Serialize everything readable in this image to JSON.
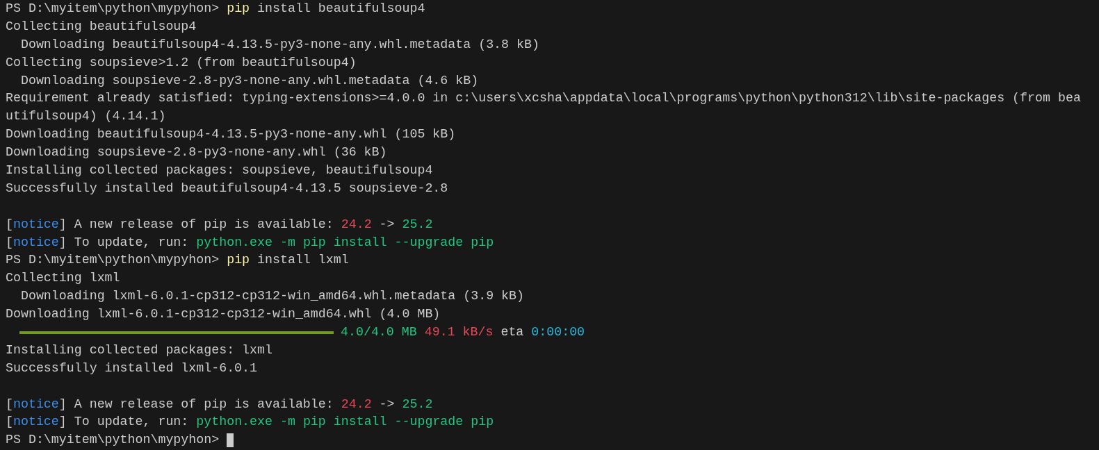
{
  "lines": [
    {
      "kind": "text",
      "segments": [
        {
          "text": "PS D:\\myitem\\python\\mypyhon> "
        },
        {
          "color": "#f9f1a5",
          "text": "pip"
        },
        {
          "text": " install beautifulsoup4"
        }
      ]
    },
    {
      "kind": "text",
      "segments": [
        {
          "text": "Collecting beautifulsoup4"
        }
      ]
    },
    {
      "kind": "text",
      "segments": [
        {
          "text": "  Downloading beautifulsoup4-4.13.5-py3-none-any.whl.metadata (3.8 kB)"
        }
      ]
    },
    {
      "kind": "text",
      "segments": [
        {
          "text": "Collecting soupsieve>1.2 (from beautifulsoup4)"
        }
      ]
    },
    {
      "kind": "text",
      "segments": [
        {
          "text": "  Downloading soupsieve-2.8-py3-none-any.whl.metadata (4.6 kB)"
        }
      ]
    },
    {
      "kind": "text",
      "segments": [
        {
          "text": "Requirement already satisfied: typing-extensions>=4.0.0 in c:\\users\\xcsha\\appdata\\local\\programs\\python\\python312\\lib\\site-packages (from bea"
        }
      ]
    },
    {
      "kind": "text",
      "segments": [
        {
          "text": "utifulsoup4) (4.14.1)"
        }
      ]
    },
    {
      "kind": "text",
      "segments": [
        {
          "text": "Downloading beautifulsoup4-4.13.5-py3-none-any.whl (105 kB)"
        }
      ]
    },
    {
      "kind": "text",
      "segments": [
        {
          "text": "Downloading soupsieve-2.8-py3-none-any.whl (36 kB)"
        }
      ]
    },
    {
      "kind": "text",
      "segments": [
        {
          "text": "Installing collected packages: soupsieve, beautifulsoup4"
        }
      ]
    },
    {
      "kind": "text",
      "segments": [
        {
          "text": "Successfully installed beautifulsoup4-4.13.5 soupsieve-2.8"
        }
      ]
    },
    {
      "kind": "blank"
    },
    {
      "kind": "text",
      "segments": [
        {
          "text": "["
        },
        {
          "color": "#3b8eea",
          "text": "notice"
        },
        {
          "text": "] A new release of pip is available: "
        },
        {
          "color": "#e74856",
          "text": "24.2"
        },
        {
          "text": " -> "
        },
        {
          "color": "#23c47e",
          "text": "25.2"
        }
      ]
    },
    {
      "kind": "text",
      "segments": [
        {
          "text": "["
        },
        {
          "color": "#3b8eea",
          "text": "notice"
        },
        {
          "text": "] To update, run: "
        },
        {
          "color": "#23c47e",
          "text": "python.exe -m pip install --upgrade pip"
        }
      ]
    },
    {
      "kind": "text",
      "segments": [
        {
          "text": "PS D:\\myitem\\python\\mypyhon> "
        },
        {
          "color": "#f9f1a5",
          "text": "pip"
        },
        {
          "text": " install lxml"
        }
      ]
    },
    {
      "kind": "text",
      "segments": [
        {
          "text": "Collecting lxml"
        }
      ]
    },
    {
      "kind": "text",
      "segments": [
        {
          "text": "  Downloading lxml-6.0.1-cp312-cp312-win_amd64.whl.metadata (3.9 kB)"
        }
      ]
    },
    {
      "kind": "text",
      "segments": [
        {
          "text": "Downloading lxml-6.0.1-cp312-cp312-win_amd64.whl (4.0 MB)"
        }
      ]
    },
    {
      "kind": "progress",
      "level": 1,
      "segments": [
        {
          "color": "#23c47e",
          "text": "4.0/4.0 MB"
        },
        {
          "color": "#e74856",
          "text": " 49.1 kB/s"
        },
        {
          "text": " eta "
        },
        {
          "color": "#29b8db",
          "text": "0:00:00"
        }
      ]
    },
    {
      "kind": "text",
      "segments": [
        {
          "text": "Installing collected packages: lxml"
        }
      ]
    },
    {
      "kind": "text",
      "segments": [
        {
          "text": "Successfully installed lxml-6.0.1"
        }
      ]
    },
    {
      "kind": "blank"
    },
    {
      "kind": "text",
      "segments": [
        {
          "text": "["
        },
        {
          "color": "#3b8eea",
          "text": "notice"
        },
        {
          "text": "] A new release of pip is available: "
        },
        {
          "color": "#e74856",
          "text": "24.2"
        },
        {
          "text": " -> "
        },
        {
          "color": "#23c47e",
          "text": "25.2"
        }
      ]
    },
    {
      "kind": "text",
      "segments": [
        {
          "text": "["
        },
        {
          "color": "#3b8eea",
          "text": "notice"
        },
        {
          "text": "] To update, run: "
        },
        {
          "color": "#23c47e",
          "text": "python.exe -m pip install --upgrade pip"
        }
      ]
    },
    {
      "kind": "prompt",
      "segments": [
        {
          "text": "PS D:\\myitem\\python\\mypyhon> "
        }
      ]
    }
  ]
}
